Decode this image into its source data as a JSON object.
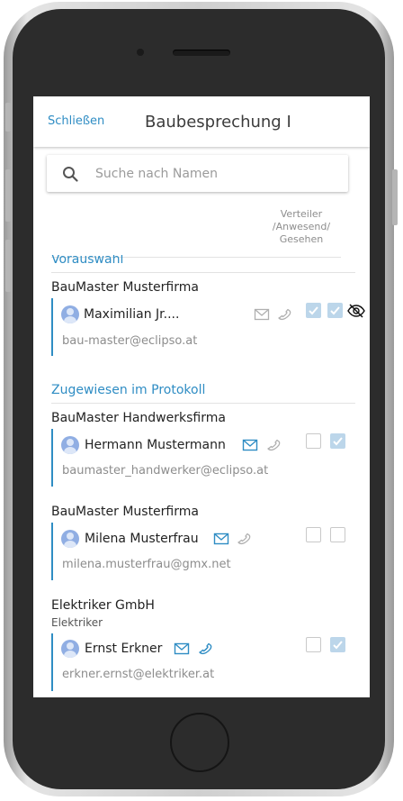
{
  "header": {
    "close_label": "Schließen",
    "title": "Baubesprechung I"
  },
  "search": {
    "placeholder": "Suche nach Namen"
  },
  "columns": {
    "line1": "Verteiler",
    "line2": "/Anwesend/",
    "line3": "Gesehen"
  },
  "sections": {
    "preselection": "Vorauswahl",
    "assigned": "Zugewiesen im Protokoll"
  },
  "contacts": [
    {
      "company": "BauMaster Musterfirma",
      "subtitle": "",
      "name": "Maximilian Jr....",
      "email": "bau-master@eclipso.at",
      "verteiler": true,
      "anwesend": true,
      "gesehen": false,
      "mail_active": false
    },
    {
      "company": "BauMaster Handwerksfirma",
      "subtitle": "",
      "name": "Hermann Mustermann",
      "email": "baumaster_handwerker@eclipso.at",
      "verteiler": false,
      "anwesend": true,
      "mail_active": true
    },
    {
      "company": "BauMaster Musterfirma",
      "subtitle": "",
      "name": "Milena Musterfrau",
      "email": "milena.musterfrau@gmx.net",
      "verteiler": false,
      "anwesend": false,
      "mail_active": true
    },
    {
      "company": "Elektriker GmbH",
      "subtitle": "Elektriker",
      "name": "Ernst Erkner",
      "email": "erkner.ernst@elektriker.at",
      "verteiler": false,
      "anwesend": true,
      "mail_active": true
    }
  ],
  "colors": {
    "accent": "#2f8dc4",
    "checked": "#bcd6ea",
    "avatar": "#90aee3"
  }
}
